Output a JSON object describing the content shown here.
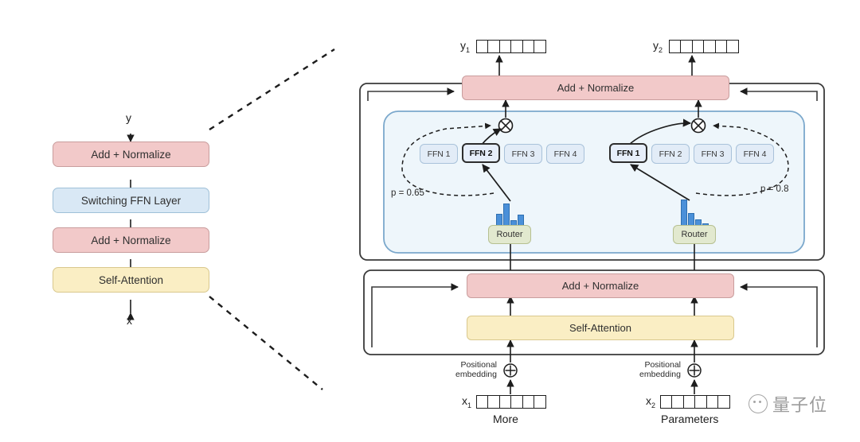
{
  "figure": {
    "title": "Switch Transformer encoder block diagram",
    "colors": {
      "pink": "#f2c9c9",
      "blue": "#d9e8f5",
      "yellow": "#faeec4",
      "ffn_chip": "#e2ecf7",
      "router_chip": "#e2e9cf",
      "histogram_bar": "#4a90d9",
      "panel_blue": "#eef6fb",
      "outline": "#3a3a3a"
    }
  },
  "left_diagram": {
    "output_label": "y",
    "input_label": "x",
    "blocks": [
      {
        "label": "Add + Normalize",
        "style": "pink"
      },
      {
        "label": "Switching FFN Layer",
        "style": "blue"
      },
      {
        "label": "Add + Normalize",
        "style": "pink"
      },
      {
        "label": "Self-Attention",
        "style": "yellow"
      }
    ]
  },
  "right_diagram": {
    "top_norm_label": "Add + Normalize",
    "bottom_norm_label": "Add + Normalize",
    "self_attention_label": "Self-Attention",
    "outputs": [
      {
        "name": "y1",
        "base": "y",
        "sub": "1",
        "cells": 6
      },
      {
        "name": "y2",
        "base": "y",
        "sub": "2",
        "cells": 6
      }
    ],
    "inputs": [
      {
        "name": "x1",
        "base": "x",
        "sub": "1",
        "cells": 6,
        "word": "More",
        "positional_embedding": "Positional\nembedding",
        "pos_line1": "Positional",
        "pos_line2": "embedding"
      },
      {
        "name": "x2",
        "base": "x",
        "sub": "2",
        "cells": 6,
        "word": "Parameters",
        "positional_embedding": "Positional\nembedding",
        "pos_line1": "Positional",
        "pos_line2": "embedding"
      }
    ],
    "experts": [
      {
        "token": "x1",
        "router_label": "Router",
        "probability_label": "p = 0.65",
        "probability": 0.65,
        "selected_index": 1,
        "ffns": [
          {
            "label": "FFN 1",
            "active": false
          },
          {
            "label": "FFN 2",
            "active": true
          },
          {
            "label": "FFN 3",
            "active": false
          },
          {
            "label": "FFN 4",
            "active": false
          }
        ],
        "router_distribution": [
          0.45,
          0.65,
          0.18,
          0.38
        ]
      },
      {
        "token": "x2",
        "router_label": "Router",
        "probability_label": "p = 0.8",
        "probability": 0.8,
        "selected_index": 0,
        "ffns": [
          {
            "label": "FFN 1",
            "active": true
          },
          {
            "label": "FFN 2",
            "active": false
          },
          {
            "label": "FFN 3",
            "active": false
          },
          {
            "label": "FFN 4",
            "active": false
          }
        ],
        "router_distribution": [
          0.8,
          0.35,
          0.18,
          0.08
        ]
      }
    ],
    "multiply_icon": "circled-times"
  },
  "watermark": {
    "text": "量子位"
  }
}
